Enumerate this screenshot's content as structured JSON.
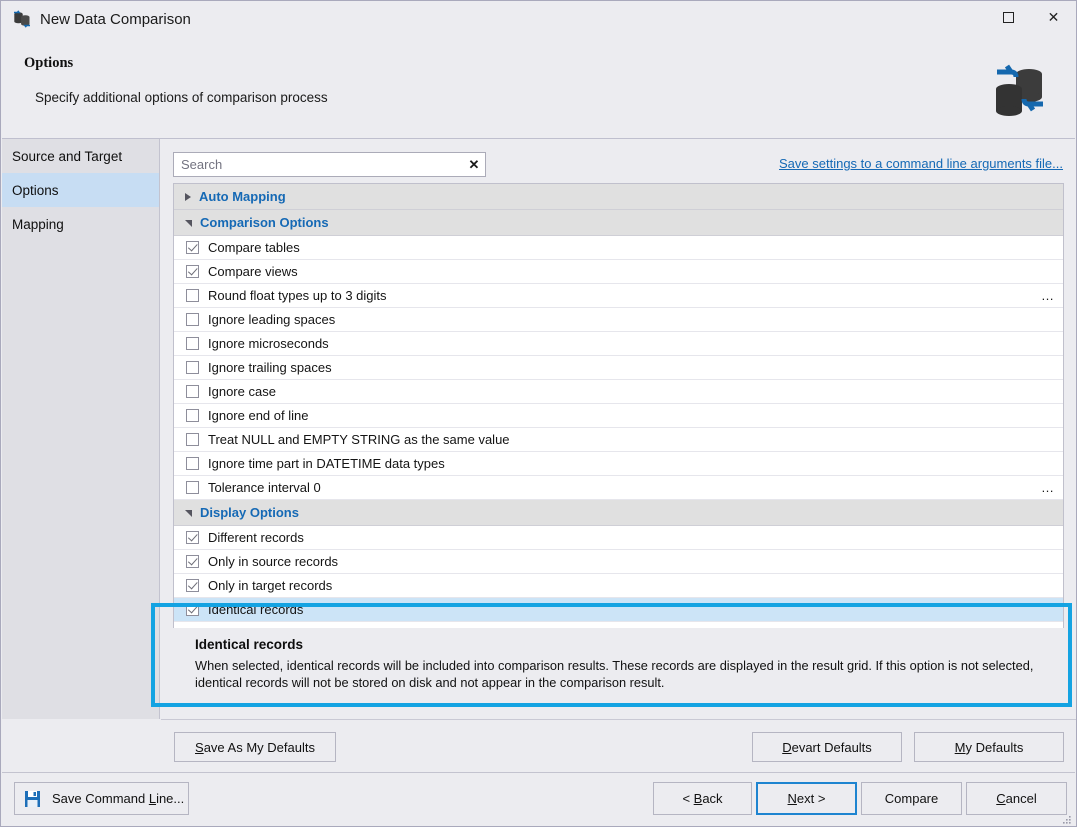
{
  "window": {
    "title": "New Data Comparison",
    "icon": "database-compare-icon",
    "maximize_label": "maximize-icon",
    "close_label": "✕"
  },
  "header": {
    "title": "Options",
    "subtitle": "Specify additional options of comparison process",
    "logo": "database-sync-logo"
  },
  "sidebar": {
    "items": [
      {
        "label": "Source and Target",
        "active": false
      },
      {
        "label": "Options",
        "active": true
      },
      {
        "label": "Mapping",
        "active": false
      }
    ]
  },
  "search": {
    "value": "",
    "placeholder": "Search",
    "clear_label": "✕"
  },
  "save_link": "Save settings to a command line arguments file...",
  "groups": [
    {
      "title": "Auto Mapping",
      "expanded": false,
      "options": []
    },
    {
      "title": "Comparison Options",
      "expanded": true,
      "options": [
        {
          "label": "Compare tables",
          "checked": true,
          "ellipsis": false,
          "selected": false
        },
        {
          "label": "Compare views",
          "checked": true,
          "ellipsis": false,
          "selected": false
        },
        {
          "label": "Round float types up to 3 digits",
          "checked": false,
          "ellipsis": true,
          "selected": false
        },
        {
          "label": "Ignore leading spaces",
          "checked": false,
          "ellipsis": false,
          "selected": false
        },
        {
          "label": "Ignore microseconds",
          "checked": false,
          "ellipsis": false,
          "selected": false
        },
        {
          "label": "Ignore trailing spaces",
          "checked": false,
          "ellipsis": false,
          "selected": false
        },
        {
          "label": "Ignore case",
          "checked": false,
          "ellipsis": false,
          "selected": false
        },
        {
          "label": "Ignore end of line",
          "checked": false,
          "ellipsis": false,
          "selected": false
        },
        {
          "label": "Treat NULL and EMPTY STRING as the same value",
          "checked": false,
          "ellipsis": false,
          "selected": false
        },
        {
          "label": "Ignore time part in DATETIME data types",
          "checked": false,
          "ellipsis": false,
          "selected": false
        },
        {
          "label": "Tolerance interval 0",
          "checked": false,
          "ellipsis": true,
          "selected": false
        }
      ]
    },
    {
      "title": "Display Options",
      "expanded": true,
      "options": [
        {
          "label": "Different records",
          "checked": true,
          "ellipsis": false,
          "selected": false
        },
        {
          "label": "Only in source records",
          "checked": true,
          "ellipsis": false,
          "selected": false
        },
        {
          "label": "Only in target records",
          "checked": true,
          "ellipsis": false,
          "selected": false
        },
        {
          "label": "Identical records",
          "checked": true,
          "ellipsis": false,
          "selected": true
        }
      ]
    }
  ],
  "description": {
    "title": "Identical records",
    "body": "When selected, identical records will be included into comparison results. These records are displayed in the result grid. If this option is not selected, identical records will not be stored on disk and not appear in the comparison result."
  },
  "ellipsis_label": "…",
  "defaults_buttons": {
    "save_as_my_defaults": {
      "mnemonic": "S",
      "rest": "ave As My Defaults"
    },
    "devart_defaults": {
      "mnemonic": "D",
      "rest": "evart Defaults"
    },
    "my_defaults": {
      "mnemonic": "M",
      "rest": "y Defaults"
    }
  },
  "footer": {
    "save_command_line": {
      "pre": "Save Command ",
      "mnemonic": "L",
      "rest": "ine..."
    },
    "back": {
      "pre": "< ",
      "mnemonic": "B",
      "rest": "ack"
    },
    "next": {
      "mnemonic": "N",
      "rest": "ext >"
    },
    "compare": {
      "mnemonic": "",
      "rest": "Compare"
    },
    "cancel": {
      "mnemonic": "C",
      "rest": "ancel"
    }
  },
  "colors": {
    "accent_blue": "#1569B5",
    "highlight_ring": "#14A3E2",
    "selection_blue": "#CCE4F7",
    "sidebar_active": "#C7DDF3",
    "window_bg": "#ECECF0"
  }
}
